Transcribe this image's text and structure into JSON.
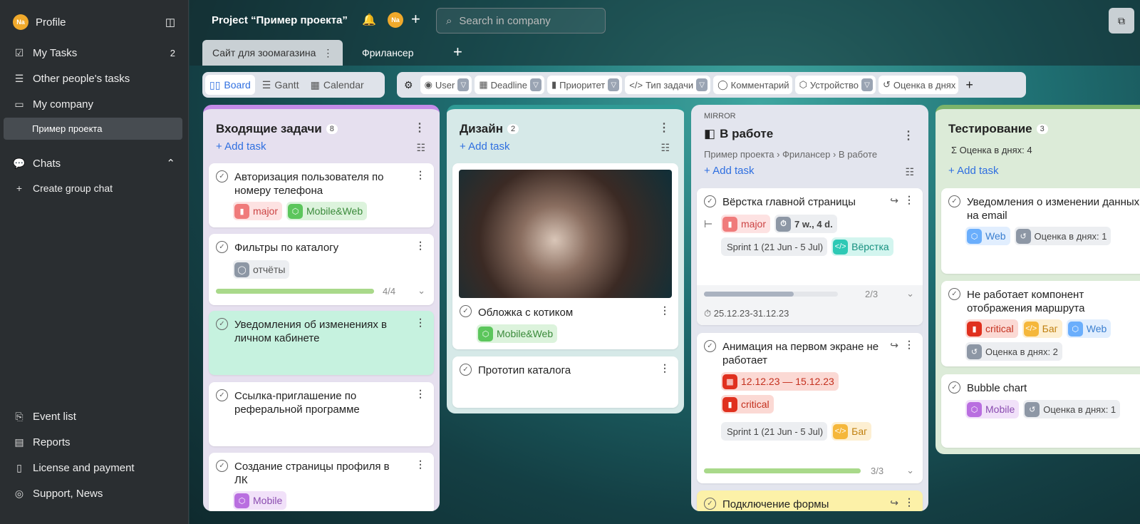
{
  "sidebar": {
    "profile": "Profile",
    "avatar": "Na",
    "my_tasks": "My Tasks",
    "my_tasks_count": "2",
    "other_tasks": "Other people's tasks",
    "my_company": "My company",
    "project": "Пример проекта",
    "chats": "Chats",
    "create_chat": "Create group chat",
    "event_list": "Event list",
    "reports": "Reports",
    "license": "License and payment",
    "support": "Support, News"
  },
  "topbar": {
    "project_title": "Project “Пример проекта”",
    "avatar": "Na",
    "search_placeholder": "Search in company",
    "tabs": [
      "Сайт для зоомагазина",
      "Фрилансер"
    ]
  },
  "views": {
    "board": "Board",
    "gantt": "Gantt",
    "calendar": "Calendar"
  },
  "filters": [
    "User",
    "Deadline",
    "Приоритет",
    "Тип задачи",
    "Комментарий",
    "Устройство",
    "Оценка в днях"
  ],
  "columns": {
    "c1": {
      "title": "Входящие задачи",
      "count": "8",
      "add": "Add task",
      "cards": [
        {
          "title": "Авторизация пользователя по номеру телефона",
          "tags": [
            "major",
            "Mobile&Web"
          ]
        },
        {
          "title": "Фильтры по каталогу",
          "tags": [
            "отчёты"
          ],
          "progress": "4/4",
          "progress_value": 1.0
        },
        {
          "title": "Уведомления об изменениях в личном кабинете"
        },
        {
          "title": "Ссылка-приглашение по реферальной программе"
        },
        {
          "title": "Создание страницы профиля в ЛК",
          "tags": [
            "Mobile"
          ]
        }
      ]
    },
    "c2": {
      "title": "Дизайн",
      "count": "2",
      "add": "Add task",
      "cards": [
        {
          "title": "Обложка с котиком",
          "tags": [
            "Mobile&Web"
          ]
        },
        {
          "title": "Прототип каталога"
        }
      ]
    },
    "c3": {
      "mirror": "MIRROR",
      "title": "В работе",
      "crumbs": [
        "Пример проекта",
        "Фрилансер",
        "В работе"
      ],
      "add": "Add task",
      "cards": [
        {
          "title": "Вёрстка главной страницы",
          "tags": [
            "major",
            "7 w., 4 d.",
            "Sprint 1 (21 Jun - 5 Jul)",
            "Вёрстка"
          ],
          "progress": "2/3",
          "progress_value": 0.67,
          "dates": "25.12.23-31.12.23"
        },
        {
          "title": "Анимация на первом экране не работает",
          "tags": [
            "12.12.23 — 15.12.23",
            "critical",
            "Sprint 1 (21 Jun - 5 Jul)",
            "Баг"
          ],
          "progress": "3/3",
          "progress_value": 1.0
        },
        {
          "title": "Подключение формы"
        }
      ]
    },
    "c4": {
      "title": "Тестирование",
      "count": "3",
      "sum": "Оценка в днях: 4",
      "add": "Add task",
      "cards": [
        {
          "title": "Уведомления о изменении данных на email",
          "tags": [
            "Web",
            "Оценка в днях: 1"
          ]
        },
        {
          "title": "Не работает компонент отображения маршрута",
          "tags": [
            "critical",
            "Баг",
            "Web",
            "Оценка в днях: 2"
          ]
        },
        {
          "title": "Bubble chart",
          "tags": [
            "Mobile",
            "Оценка в днях: 1"
          ]
        }
      ]
    }
  },
  "colors": {
    "accent": "#2f6fe0",
    "major": "#f07b7b",
    "critical": "#e0301e",
    "web": "#6aaefc",
    "mobile": "#b96ee0",
    "mobileweb": "#5cc65c",
    "bug": "#f5b73b",
    "verstka": "#2ec9b5"
  }
}
